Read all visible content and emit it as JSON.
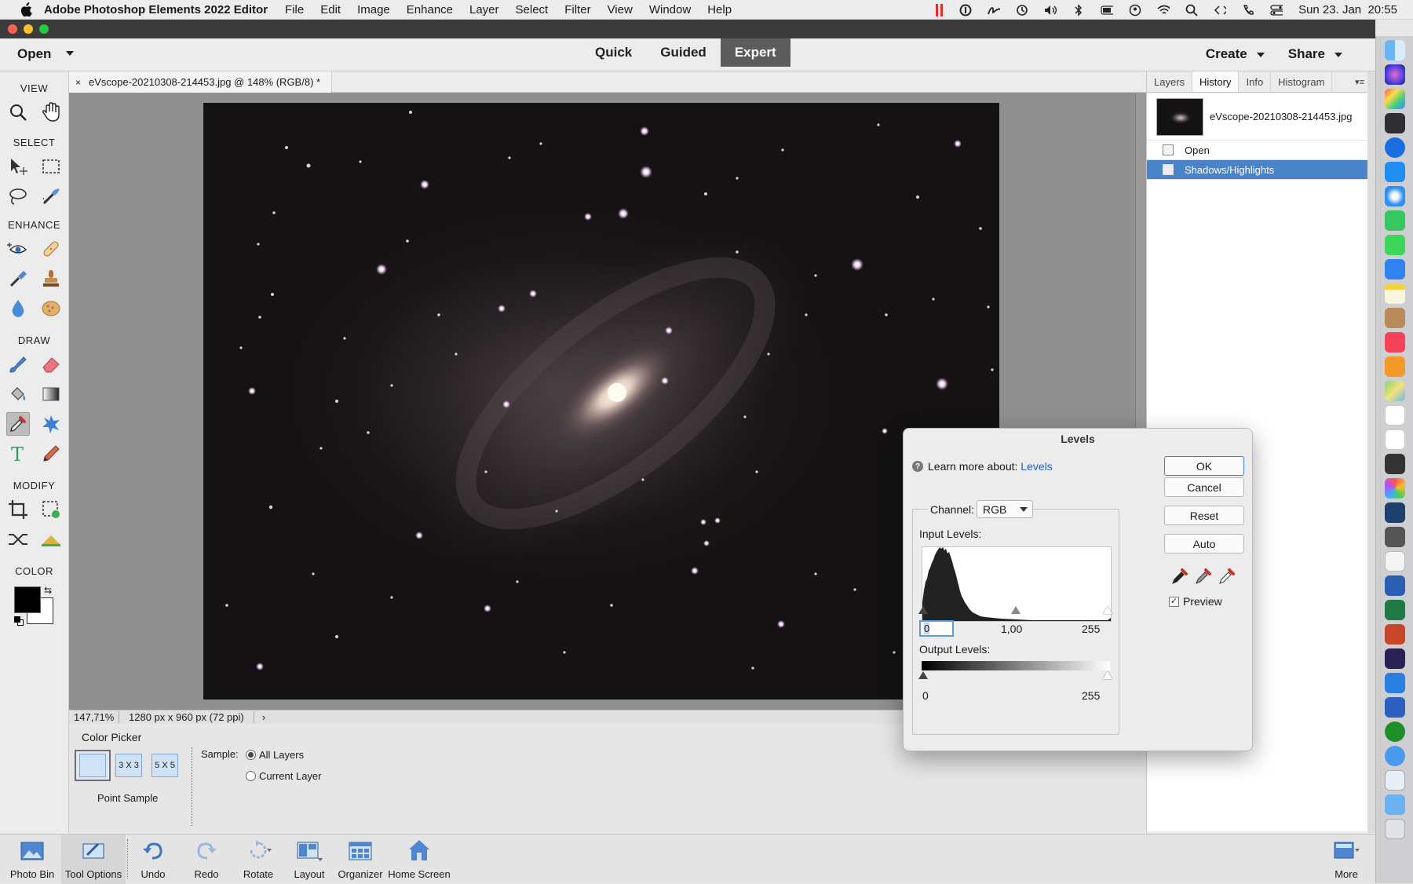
{
  "menubar": {
    "app_name": "Adobe Photoshop Elements 2022 Editor",
    "items": [
      "File",
      "Edit",
      "Image",
      "Enhance",
      "Layer",
      "Select",
      "Filter",
      "View",
      "Window",
      "Help"
    ],
    "datetime": "Sun 23. Jan  20:55"
  },
  "header": {
    "open_label": "Open",
    "modes": [
      {
        "label": "Quick"
      },
      {
        "label": "Guided"
      },
      {
        "label": "Expert"
      }
    ],
    "active_mode": "Expert",
    "create_label": "Create",
    "share_label": "Share"
  },
  "toolbox": {
    "sections": {
      "view": "VIEW",
      "select": "SELECT",
      "enhance": "ENHANCE",
      "draw": "DRAW",
      "modify": "MODIFY",
      "color": "COLOR"
    }
  },
  "document": {
    "tab_title": "eVscope-20210308-214453.jpg @ 148% (RGB/8) *",
    "zoom_readout": "147,71%",
    "dimensions": "1280 px x 960 px (72 ppi)"
  },
  "tool_options": {
    "title": "Color Picker",
    "sizes": [
      "3 X 3",
      "5 X 5"
    ],
    "point_sample_label": "Point Sample",
    "sample_label": "Sample:",
    "sample_options": [
      "All Layers",
      "Current Layer"
    ],
    "sample_selected": "All Layers"
  },
  "panel": {
    "tabs": [
      "Layers",
      "History",
      "Info",
      "Histogram"
    ],
    "active_tab": "History",
    "snapshot_name": "eVscope-20210308-214453.jpg",
    "history": [
      "Open",
      "Shadows/Highlights"
    ],
    "history_selected": "Shadows/Highlights"
  },
  "levels": {
    "title": "Levels",
    "learn_text": "Learn more about:",
    "learn_link": "Levels",
    "channel_label": "Channel:",
    "channel_value": "RGB",
    "input_levels_label": "Input Levels:",
    "input_black": "0",
    "input_gamma": "1,00",
    "input_white": "255",
    "output_levels_label": "Output Levels:",
    "output_black": "0",
    "output_white": "255",
    "buttons": {
      "ok": "OK",
      "cancel": "Cancel",
      "reset": "Reset",
      "auto": "Auto"
    },
    "preview_label": "Preview",
    "preview_checked": true
  },
  "bottombar": {
    "items": [
      "Photo Bin",
      "Tool Options",
      "Undo",
      "Redo",
      "Rotate",
      "Layout",
      "Organizer",
      "Home Screen"
    ],
    "more_label": "More"
  },
  "colors": {
    "accent": "#3c7fd3",
    "selection": "#4a84c8",
    "link": "#1f5fc4"
  }
}
